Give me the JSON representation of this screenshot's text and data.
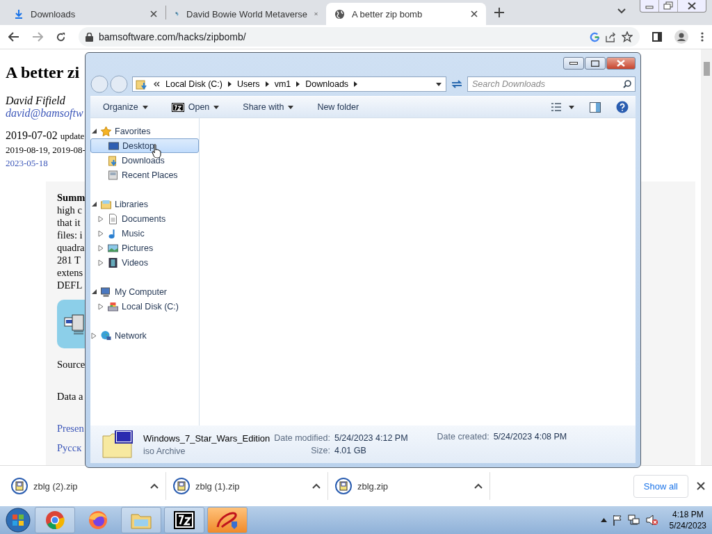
{
  "browser": {
    "tabs": [
      {
        "title": "Downloads",
        "selected": false
      },
      {
        "title": "David Bowie World Metaverse",
        "selected": false
      },
      {
        "title": "A better zip bomb",
        "selected": true
      }
    ],
    "address": "bamsoftware.com/hacks/zipbomb/"
  },
  "page": {
    "title": "A better zi",
    "author": "David Fifield",
    "email": "david@bamsoftw",
    "date": "2019-07-02",
    "update_label": "update",
    "updates_line": "2019-08-19, 2019-08-",
    "last_update": "2023-05-18",
    "summary_lines": [
      "high c",
      "that it",
      "files: i",
      "quadra",
      "281 T",
      "extens",
      "DEFL"
    ],
    "summary_label": "Summ",
    "source": "Source",
    "data": "Data a",
    "links": [
      "Presen",
      "Русск"
    ]
  },
  "explorer": {
    "breadcrumb": [
      "Local Disk (C:)",
      "Users",
      "vm1",
      "Downloads"
    ],
    "search_placeholder": "Search Downloads",
    "toolbar": [
      {
        "label": "Organize",
        "has_menu": true
      },
      {
        "label": "Open",
        "has_menu": true
      },
      {
        "label": "Share with",
        "has_menu": true
      },
      {
        "label": "New folder",
        "has_menu": false
      }
    ],
    "nav": [
      {
        "label": "Favorites",
        "expanded": true,
        "selected": false,
        "children": [
          {
            "label": "Desktop",
            "selected": true
          },
          {
            "label": "Downloads",
            "selected": false
          },
          {
            "label": "Recent Places",
            "selected": false
          }
        ]
      },
      {
        "label": "Libraries",
        "expanded": true,
        "selected": false,
        "children": [
          {
            "label": "Documents",
            "selected": false,
            "expanded": false
          },
          {
            "label": "Music",
            "selected": false,
            "expanded": false
          },
          {
            "label": "Pictures",
            "selected": false,
            "expanded": false
          },
          {
            "label": "Videos",
            "selected": false,
            "expanded": false
          }
        ]
      },
      {
        "label": "My Computer",
        "expanded": true,
        "selected": false,
        "children": [
          {
            "label": "Local Disk (C:)",
            "selected": false,
            "expanded": false
          }
        ]
      },
      {
        "label": "Network",
        "expanded": false,
        "selected": false
      }
    ],
    "details": {
      "name": "Windows_7_Star_Wars_Edition",
      "type": "iso Archive",
      "modified_label": "Date modified:",
      "modified": "5/24/2023 4:12 PM",
      "created_label": "Date created:",
      "created": "5/24/2023 4:08 PM",
      "size_label": "Size:",
      "size": "4.01 GB"
    }
  },
  "downloads": [
    {
      "name": "zblg (2).zip"
    },
    {
      "name": "zblg (1).zip"
    },
    {
      "name": "zblg.zip"
    }
  ],
  "show_all": "Show all",
  "taskbar": {
    "time": "4:18 PM",
    "date": "5/24/2023"
  }
}
